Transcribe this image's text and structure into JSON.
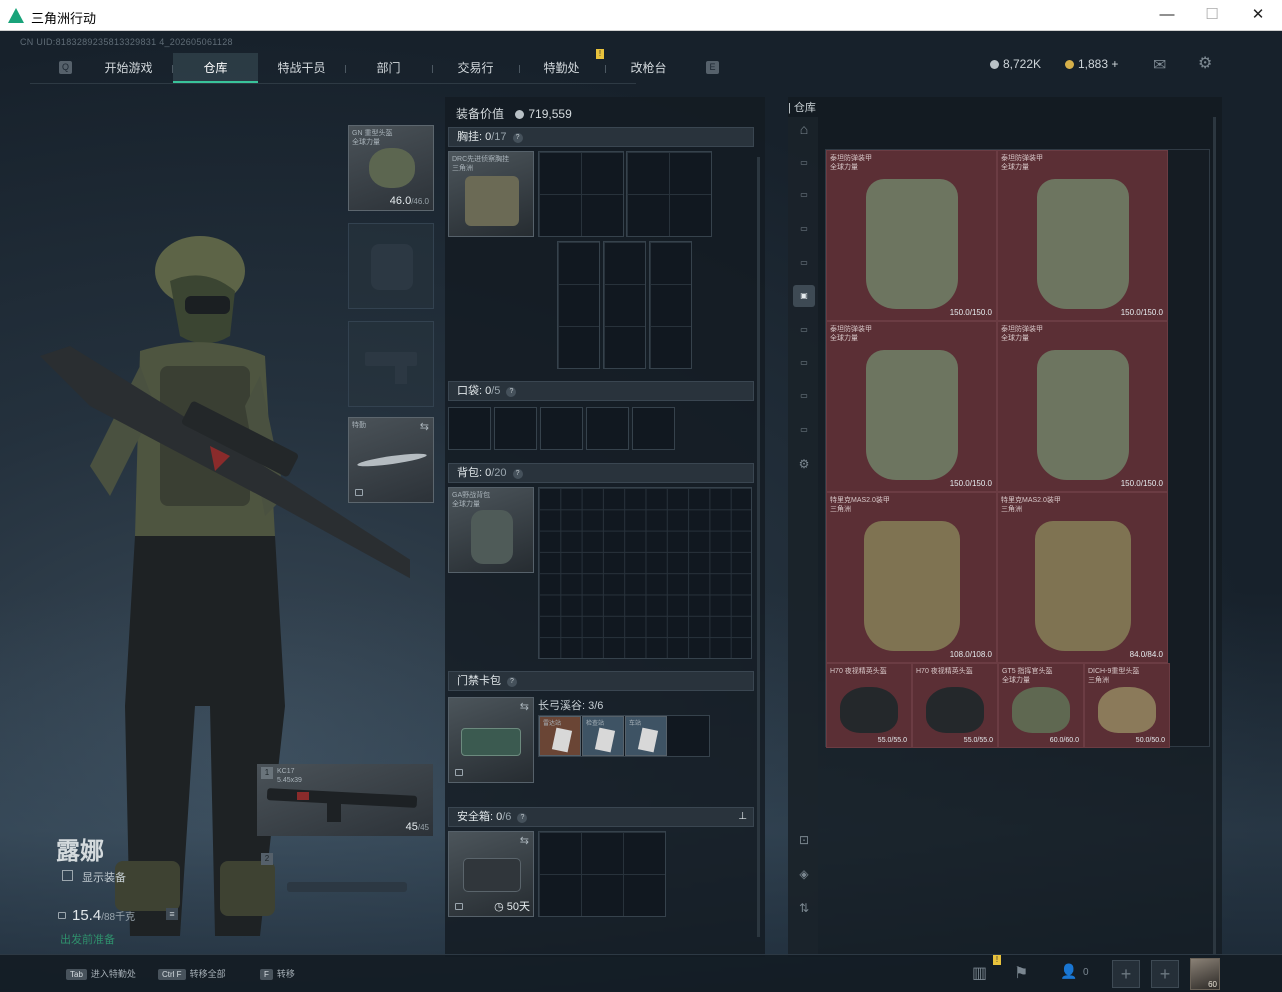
{
  "window": {
    "title": "三角洲行动",
    "minimize": "—",
    "maximize": "☐",
    "close": "✕"
  },
  "uid": "CN UID:8183289235813329831 4_202605061128",
  "nav": {
    "tabs": [
      {
        "label": "开始游戏"
      },
      {
        "label": "仓库",
        "active": true
      },
      {
        "label": "特战干员"
      },
      {
        "label": "部门"
      },
      {
        "label": "交易行"
      },
      {
        "label": "特勤处",
        "badge": "!"
      },
      {
        "label": "改枪台"
      }
    ],
    "left_key": "Q",
    "right_key": "E"
  },
  "currency": {
    "silver": "8,722K",
    "gold": "1,883",
    "add": "+"
  },
  "character": {
    "name": "露娜",
    "show_equipment_label": "显示装备",
    "weight": "15.4",
    "weight_max": "/88千克",
    "status_text": "出发前准备"
  },
  "gear_slots": {
    "helmet": {
      "name": "GN 重型头盔",
      "sub": "全球力量",
      "dur": "46.0",
      "dur_max": "/46.0"
    },
    "melee": {
      "name": "特勤"
    },
    "primary": {
      "index": "1",
      "name": "KC17",
      "sub": "5.45x39",
      "ammo": "45",
      "ammo_max": "/45"
    },
    "secondary": {
      "index": "2"
    }
  },
  "middle": {
    "equip_value_label": "装备价值",
    "equip_value": "719,559",
    "chest": {
      "label": "胸挂:",
      "count": "0",
      "max": "/17",
      "item": "DRC先进侦察胸挂",
      "item_sub": "三角洲"
    },
    "pocket": {
      "label": "口袋:",
      "count": "0",
      "max": "/5"
    },
    "backpack": {
      "label": "背包:",
      "count": "0",
      "max": "/20",
      "item": "GA野战背包",
      "item_sub": "全球力量"
    },
    "keycard": {
      "label": "门禁卡包",
      "map": "长弓溪谷: 3/6",
      "cards": [
        {
          "name": "雷达站"
        },
        {
          "name": "检查站"
        },
        {
          "name": "车站"
        }
      ]
    },
    "safebox": {
      "label": "安全箱:",
      "count": "0",
      "max": "/6",
      "days": "50天"
    }
  },
  "warehouse": {
    "label": "仓库",
    "items": [
      {
        "name": "泰坦防弹装甲",
        "sub": "全球力量",
        "dur": "150.0/150.0"
      },
      {
        "name": "泰坦防弹装甲",
        "sub": "全球力量",
        "dur": "150.0/150.0"
      },
      {
        "name": "泰坦防弹装甲",
        "sub": "全球力量",
        "dur": "150.0/150.0"
      },
      {
        "name": "泰坦防弹装甲",
        "sub": "全球力量",
        "dur": "150.0/150.0"
      },
      {
        "name": "特里克MAS2.0装甲",
        "sub": "三角洲",
        "dur": "108.0/108.0"
      },
      {
        "name": "特里克MAS2.0装甲",
        "sub": "三角洲",
        "dur": "84.0/84.0"
      },
      {
        "name": "H70 夜视精英头盔",
        "sub": "",
        "dur": "55.0/55.0"
      },
      {
        "name": "H70 夜视精英头盔",
        "sub": "",
        "dur": "55.0/55.0"
      },
      {
        "name": "GT5 指挥官头盔",
        "sub": "全球力量",
        "dur": "60.0/60.0"
      },
      {
        "name": "DICH-9重型头盔",
        "sub": "三角洲",
        "dur": "50.0/50.0"
      }
    ]
  },
  "bottom": {
    "hints": [
      {
        "key": "Tab",
        "label": "进入特勤处"
      },
      {
        "key": "Ctrl F",
        "label": "转移全部"
      },
      {
        "key": "F",
        "label": "转移"
      }
    ],
    "friends_count": "0",
    "level": "60"
  },
  "colors": {
    "accent": "#39c39a",
    "warehouse_item_bg": "#5b2f35",
    "badge": "#e8c23c"
  }
}
